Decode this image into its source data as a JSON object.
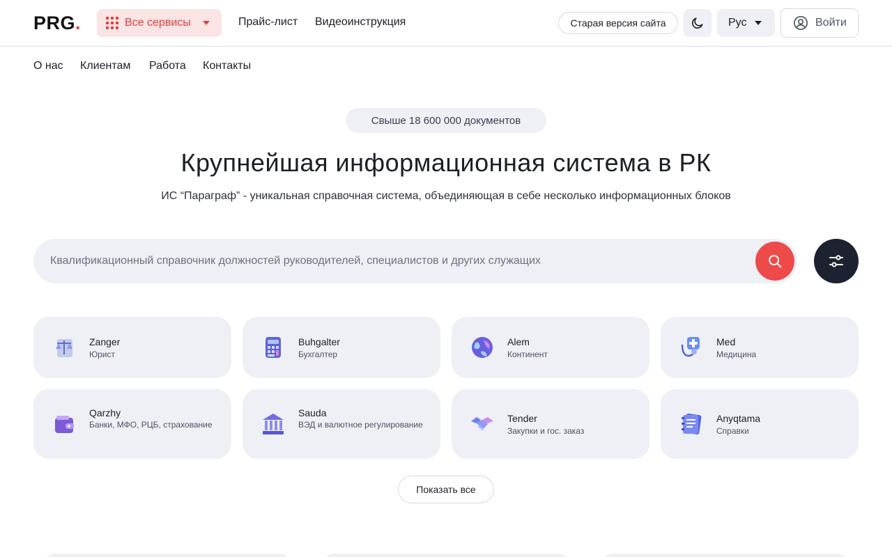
{
  "header": {
    "logo_text": "PRG",
    "logo_dot": ".",
    "services_label": "Все сервисы",
    "nav": [
      "Прайс-лист",
      "Видеоинструкция"
    ],
    "old_site_label": "Старая версия сайта",
    "language": "Рус",
    "login_label": "Войти"
  },
  "subnav": [
    "О нас",
    "Клиентам",
    "Работа",
    "Контакты"
  ],
  "hero": {
    "badge": "Свыше 18 600 000 документов",
    "title": "Крупнейшая информационная система в РК",
    "subtitle": "ИС “Параграф” - уникальная справочная система, объединяющая в себе несколько информационных блоков"
  },
  "search": {
    "placeholder": "Квалификационный справочник должностей руководителей, специалистов и других служащих"
  },
  "services": [
    {
      "name": "Zanger",
      "desc": "Юрист",
      "icon": "scales-icon"
    },
    {
      "name": "Buhgalter",
      "desc": "Бухгалтер",
      "icon": "calculator-icon"
    },
    {
      "name": "Alem",
      "desc": "Континент",
      "icon": "globe-icon"
    },
    {
      "name": "Med",
      "desc": "Медицина",
      "icon": "medkit-icon"
    },
    {
      "name": "Qarzhy",
      "desc": "Банки, МФО, РЦБ, страхование",
      "icon": "wallet-icon"
    },
    {
      "name": "Sauda",
      "desc": "ВЭД и валютное регулирование",
      "icon": "bank-icon"
    },
    {
      "name": "Tender",
      "desc": "Закупки и гос. заказ",
      "icon": "handshake-icon"
    },
    {
      "name": "Anyqtama",
      "desc": "Справки",
      "icon": "notebook-icon"
    }
  ],
  "show_all_label": "Показать все",
  "colors": {
    "accent": "#ee4a4a",
    "accent_bg": "#fbe4e4",
    "card_bg": "#eef0f6",
    "dark_button": "#1c2230"
  }
}
